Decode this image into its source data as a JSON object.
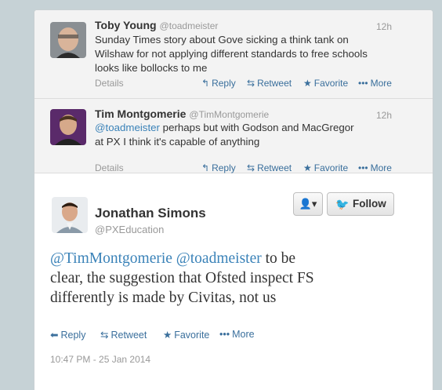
{
  "replies": [
    {
      "name": "Toby Young",
      "handle": "@toadmeister",
      "time": "12h",
      "text_lines": [
        "Sunday Times story about Gove sicking a think tank on",
        "Wilshaw for not applying different standards to free schools",
        "looks like bollocks to me"
      ],
      "details": "Details"
    },
    {
      "name": "Tim Montgomerie",
      "handle": "@TimMontgomerie",
      "time": "12h",
      "mention": "@toadmeister",
      "text_first": " perhaps but with Godson and MacGregor",
      "text_second": "at PX I think it's capable of anything",
      "details": "Details"
    }
  ],
  "actions": {
    "reply": "Reply",
    "retweet": "Retweet",
    "favorite": "Favorite",
    "more": "More"
  },
  "main_tweet": {
    "name": "Jonathan Simons",
    "handle": "@PXEducation",
    "follow_label": "Follow",
    "mention1": "@TimMontgomerie",
    "mention2": "@toadmeister",
    "text_line1_rest": " to be",
    "text_line2": "clear, the suggestion that Ofsted inspect FS",
    "text_line3": "differently is made by Civitas, not us",
    "timestamp": "10:47 PM - 25 Jan 2014"
  },
  "icons": {
    "reply": "reply-icon",
    "retweet": "retweet-icon",
    "favorite": "star-icon",
    "more": "more-dots-icon",
    "user": "user-dropdown-icon",
    "bird": "twitter-bird-icon"
  },
  "colors": {
    "link": "#3a82b8",
    "action": "#3a6f9c",
    "muted": "#999999",
    "reply_bg": "#f3f3f3"
  }
}
